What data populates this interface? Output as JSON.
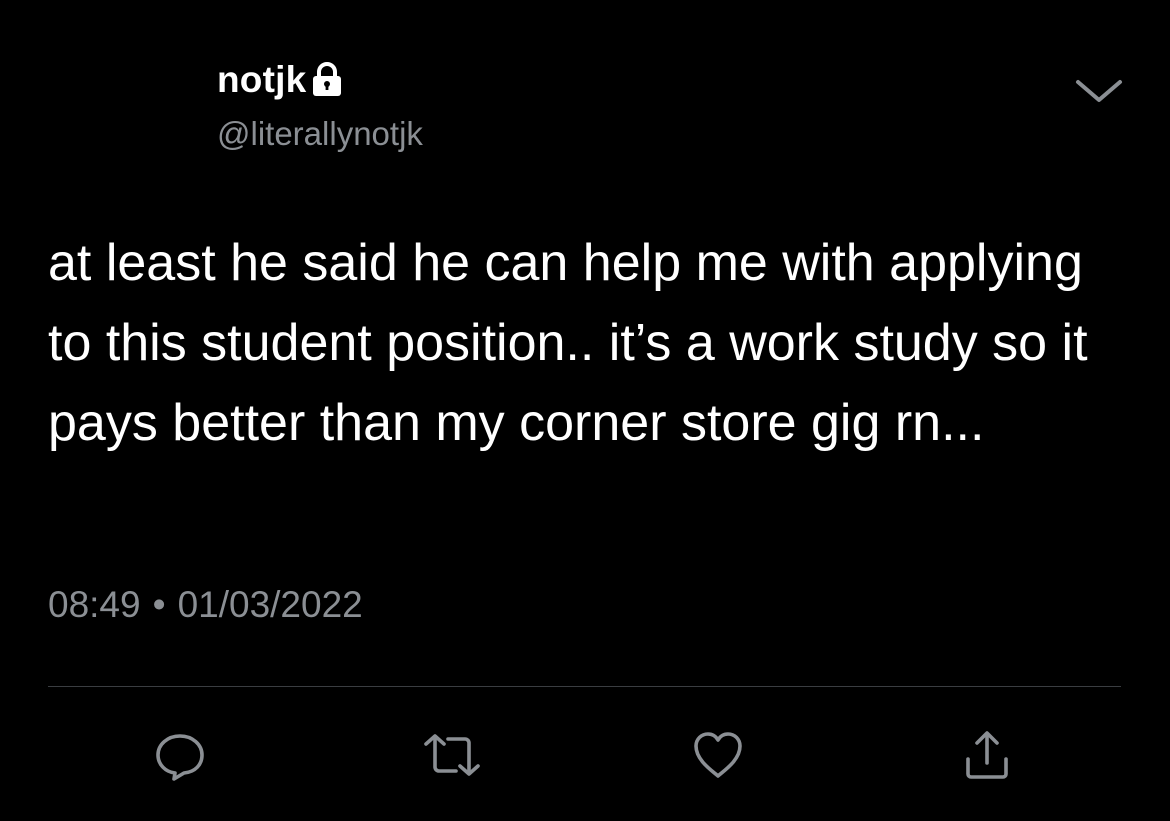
{
  "tweet": {
    "display_name": "notjk",
    "handle": "@literallynotjk",
    "text": "at least he said he can help me with applying to this student position.. it’s a work study so it pays better than my corner store gig rn...",
    "time": "08:49",
    "separator": "•",
    "date": "01/03/2022",
    "protected_icon": "lock-icon"
  },
  "actions": {
    "reply_icon": "reply-icon",
    "retweet_icon": "retweet-icon",
    "like_icon": "heart-icon",
    "share_icon": "share-icon",
    "menu_icon": "chevron-down-icon"
  },
  "colors": {
    "background": "#000000",
    "primary_text": "#ffffff",
    "secondary_text": "#8b8f94",
    "divider": "#3a3d41"
  }
}
